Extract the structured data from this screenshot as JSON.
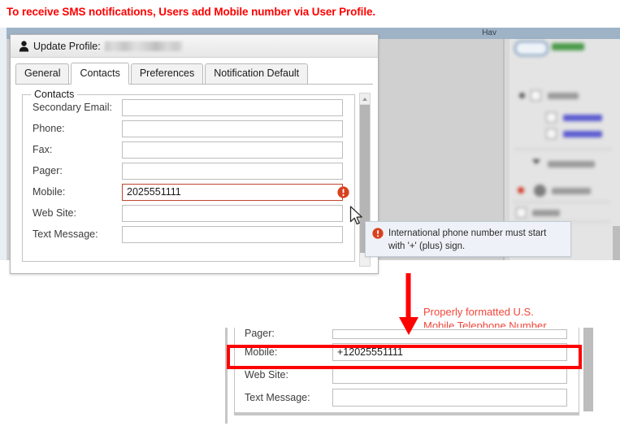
{
  "annotation": {
    "heading": "To receive SMS notifications, Users add Mobile number via User Profile.",
    "callout_line1": "Properly formatted U.S.",
    "callout_line2": "Mobile Telephone Number",
    "accent_color": "#ff0000",
    "callout_color": "#f2463a"
  },
  "background_window": {
    "titlebar_text": "Hav",
    "titlebar_color": "#9fb3c6"
  },
  "dialog": {
    "icon": "person-icon",
    "title": "Update Profile:",
    "redacted_name": "",
    "tabs": [
      {
        "label": "General",
        "active": false
      },
      {
        "label": "Contacts",
        "active": true
      },
      {
        "label": "Preferences",
        "active": false
      },
      {
        "label": "Notification Default",
        "active": false
      }
    ],
    "fieldset_legend": "Contacts",
    "fields": [
      {
        "label": "Secondary Email:",
        "value": "",
        "error": false
      },
      {
        "label": "Phone:",
        "value": "",
        "error": false
      },
      {
        "label": "Fax:",
        "value": "",
        "error": false
      },
      {
        "label": "Pager:",
        "value": "",
        "error": false
      },
      {
        "label": "Mobile:",
        "value": "2025551111",
        "error": true
      },
      {
        "label": "Web Site:",
        "value": "",
        "error": false
      },
      {
        "label": "Text Message:",
        "value": "",
        "error": false
      }
    ],
    "error_icon": "error-exclamation-icon",
    "error_color": "#c0452f"
  },
  "tooltip": {
    "icon": "error-exclamation-icon",
    "message": "International phone number must start with '+' (plus) sign.",
    "background": "#eef2f8"
  },
  "bottom_panel": {
    "fields": [
      {
        "label": "Pager:",
        "value": "",
        "clipped": true
      },
      {
        "label": "Mobile:",
        "value": "+12025551111",
        "clipped": false
      },
      {
        "label": "Web Site:",
        "value": "",
        "clipped": false
      },
      {
        "label": "Text Message:",
        "value": "",
        "clipped": false
      }
    ],
    "highlight_color": "#ff0000"
  }
}
